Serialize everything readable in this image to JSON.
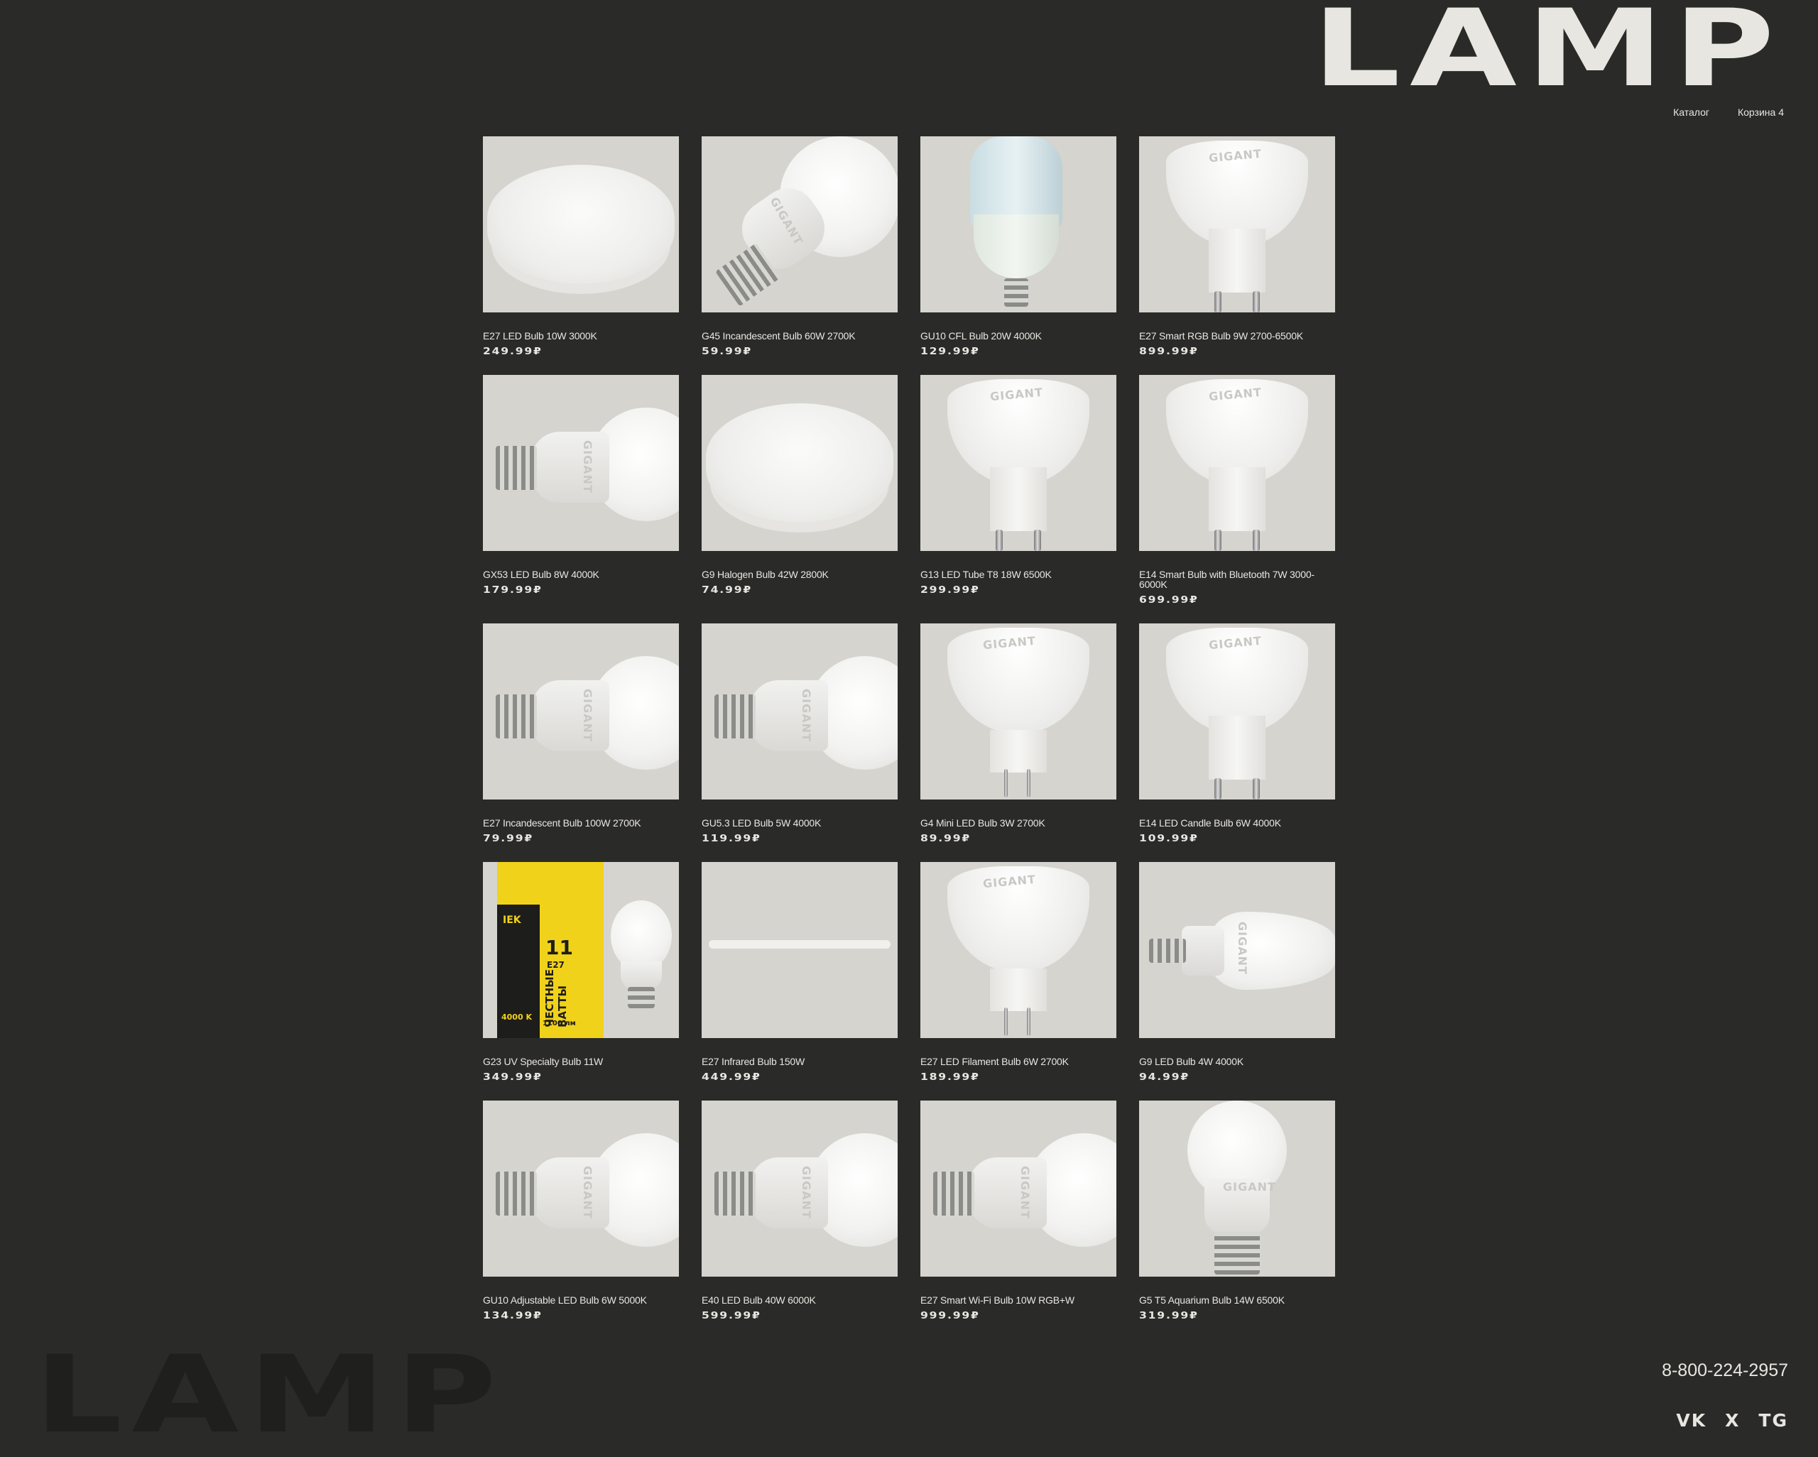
{
  "brand": {
    "logo": "LAMP"
  },
  "nav": {
    "catalog": "Каталог",
    "cart": "Корзина 4"
  },
  "products": [
    {
      "name": "E27 LED Bulb 10W 3000K",
      "price": "249.99₽",
      "image": "disc-icon"
    },
    {
      "name": "G45 Incandescent Bulb 60W 2700K",
      "price": "59.99₽",
      "image": "bulb-tilted-icon"
    },
    {
      "name": "GU10 CFL Bulb 20W 4000K",
      "price": "129.99₽",
      "image": "tube-bulb-icon"
    },
    {
      "name": "E27 Smart RGB Bulb 9W 2700-6500K",
      "price": "899.99₽",
      "image": "spot-gu10-icon"
    },
    {
      "name": "GX53 LED Bulb 8W 4000K",
      "price": "179.99₽",
      "image": "bulb-side-icon"
    },
    {
      "name": "G9 Halogen Bulb 42W 2800K",
      "price": "74.99₽",
      "image": "disc-icon"
    },
    {
      "name": "G13 LED Tube T8 18W 6500K",
      "price": "299.99₽",
      "image": "spot-gu10-icon"
    },
    {
      "name": "E14 Smart Bulb with Bluetooth 7W 3000-6000K",
      "price": "699.99₽",
      "image": "spot-gu10-icon"
    },
    {
      "name": "E27 Incandescent Bulb 100W 2700K",
      "price": "79.99₽",
      "image": "bulb-side-icon"
    },
    {
      "name": "GU5.3 LED Bulb 5W 4000K",
      "price": "119.99₽",
      "image": "bulb-side-icon"
    },
    {
      "name": "G4 Mini LED Bulb 3W 2700K",
      "price": "89.99₽",
      "image": "spot-mr16-icon"
    },
    {
      "name": "E14 LED Candle Bulb 6W 4000K",
      "price": "109.99₽",
      "image": "spot-gu10-icon"
    },
    {
      "name": "G23 UV Specialty Bulb 11W",
      "price": "349.99₽",
      "image": "boxed-bulb-icon"
    },
    {
      "name": "E27 Infrared Bulb 150W",
      "price": "449.99₽",
      "image": "linear-tube-icon"
    },
    {
      "name": "E27 LED Filament Bulb 6W 2700K",
      "price": "189.99₽",
      "image": "spot-mr16-icon"
    },
    {
      "name": "G9 LED Bulb 4W 4000K",
      "price": "94.99₽",
      "image": "candle-bulb-icon"
    },
    {
      "name": "GU10 Adjustable LED Bulb 6W 5000K",
      "price": "134.99₽",
      "image": "bulb-side-icon"
    },
    {
      "name": "E40 LED Bulb 40W 6000K",
      "price": "599.99₽",
      "image": "bulb-side-icon"
    },
    {
      "name": "E27 Smart Wi-Fi Bulb 10W RGB+W",
      "price": "999.99₽",
      "image": "bulb-side-icon"
    },
    {
      "name": "G5 T5 Aquarium Bulb 14W 6500K",
      "price": "319.99₽",
      "image": "bulb-upright-icon"
    }
  ],
  "image_text": {
    "brand_mark": "GIGANT",
    "box_brand": "IEK",
    "box_watt": "11",
    "box_base": "E27",
    "box_temp": "4000 K",
    "box_lumen": "1100 лм",
    "box_slogan": "ЧЕСТНЫЕ ВАТТЫ"
  },
  "footer": {
    "logo": "LAMP",
    "phone": "8-800-224-2957",
    "social": [
      "VK",
      "X",
      "TG"
    ]
  }
}
